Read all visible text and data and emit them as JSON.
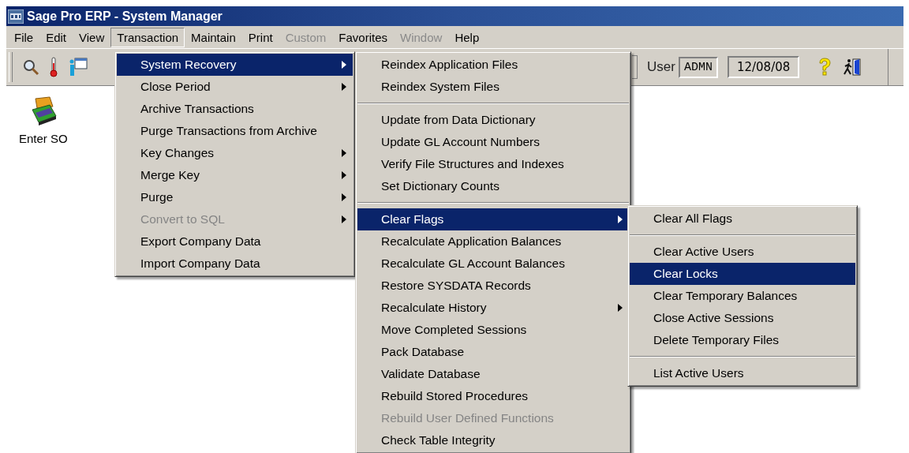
{
  "window": {
    "title": "Sage Pro ERP - System Manager"
  },
  "menu_bar": [
    {
      "label": "File",
      "selected": false,
      "disabled": false
    },
    {
      "label": "Edit",
      "selected": false,
      "disabled": false
    },
    {
      "label": "View",
      "selected": false,
      "disabled": false
    },
    {
      "label": "Transaction",
      "selected": true,
      "disabled": false
    },
    {
      "label": "Maintain",
      "selected": false,
      "disabled": false
    },
    {
      "label": "Print",
      "selected": false,
      "disabled": false
    },
    {
      "label": "Custom",
      "selected": false,
      "disabled": true
    },
    {
      "label": "Favorites",
      "selected": false,
      "disabled": false
    },
    {
      "label": "Window",
      "selected": false,
      "disabled": true
    },
    {
      "label": "Help",
      "selected": false,
      "disabled": false
    }
  ],
  "toolbar": {
    "user_label": "User",
    "user": "ADMN",
    "date": "12/08/08"
  },
  "desktop_icons": [
    {
      "label": "Enter SO"
    }
  ],
  "menus": [
    {
      "items": [
        {
          "kind": "item",
          "label": "System Recovery",
          "selected": true,
          "disabled": false,
          "submenu": true
        },
        {
          "kind": "item",
          "label": "Close Period",
          "selected": false,
          "disabled": false,
          "submenu": true
        },
        {
          "kind": "item",
          "label": "Archive Transactions",
          "selected": false,
          "disabled": false,
          "submenu": false
        },
        {
          "kind": "item",
          "label": "Purge Transactions from Archive",
          "selected": false,
          "disabled": false,
          "submenu": false
        },
        {
          "kind": "item",
          "label": "Key Changes",
          "selected": false,
          "disabled": false,
          "submenu": true
        },
        {
          "kind": "item",
          "label": "Merge Key",
          "selected": false,
          "disabled": false,
          "submenu": true
        },
        {
          "kind": "item",
          "label": "Purge",
          "selected": false,
          "disabled": false,
          "submenu": true
        },
        {
          "kind": "item",
          "label": "Convert to SQL",
          "selected": false,
          "disabled": true,
          "submenu": true
        },
        {
          "kind": "item",
          "label": "Export Company Data",
          "selected": false,
          "disabled": false,
          "submenu": false
        },
        {
          "kind": "item",
          "label": "Import Company Data",
          "selected": false,
          "disabled": false,
          "submenu": false
        }
      ]
    },
    {
      "items": [
        {
          "kind": "item",
          "label": "Reindex Application Files",
          "selected": false,
          "disabled": false,
          "submenu": false
        },
        {
          "kind": "item",
          "label": "Reindex System Files",
          "selected": false,
          "disabled": false,
          "submenu": false
        },
        {
          "kind": "separator"
        },
        {
          "kind": "item",
          "label": "Update from Data Dictionary",
          "selected": false,
          "disabled": false,
          "submenu": false
        },
        {
          "kind": "item",
          "label": "Update GL Account Numbers",
          "selected": false,
          "disabled": false,
          "submenu": false
        },
        {
          "kind": "item",
          "label": "Verify File Structures and Indexes",
          "selected": false,
          "disabled": false,
          "submenu": false
        },
        {
          "kind": "item",
          "label": "Set Dictionary Counts",
          "selected": false,
          "disabled": false,
          "submenu": false
        },
        {
          "kind": "separator"
        },
        {
          "kind": "item",
          "label": "Clear Flags",
          "selected": true,
          "disabled": false,
          "submenu": true
        },
        {
          "kind": "item",
          "label": "Recalculate Application Balances",
          "selected": false,
          "disabled": false,
          "submenu": false
        },
        {
          "kind": "item",
          "label": "Recalculate GL Account Balances",
          "selected": false,
          "disabled": false,
          "submenu": false
        },
        {
          "kind": "item",
          "label": "Restore SYSDATA Records",
          "selected": false,
          "disabled": false,
          "submenu": false
        },
        {
          "kind": "item",
          "label": "Recalculate History",
          "selected": false,
          "disabled": false,
          "submenu": true
        },
        {
          "kind": "item",
          "label": "Move Completed Sessions",
          "selected": false,
          "disabled": false,
          "submenu": false
        },
        {
          "kind": "item",
          "label": "Pack Database",
          "selected": false,
          "disabled": false,
          "submenu": false
        },
        {
          "kind": "item",
          "label": "Validate Database",
          "selected": false,
          "disabled": false,
          "submenu": false
        },
        {
          "kind": "item",
          "label": "Rebuild Stored Procedures",
          "selected": false,
          "disabled": false,
          "submenu": false
        },
        {
          "kind": "item",
          "label": "Rebuild User Defined Functions",
          "selected": false,
          "disabled": true,
          "submenu": false
        },
        {
          "kind": "item",
          "label": "Check Table Integrity",
          "selected": false,
          "disabled": false,
          "submenu": false
        }
      ]
    },
    {
      "items": [
        {
          "kind": "item",
          "label": "Clear All Flags",
          "selected": false,
          "disabled": false,
          "submenu": false
        },
        {
          "kind": "separator"
        },
        {
          "kind": "item",
          "label": "Clear Active Users",
          "selected": false,
          "disabled": false,
          "submenu": false
        },
        {
          "kind": "item",
          "label": "Clear Locks",
          "selected": true,
          "disabled": false,
          "submenu": false
        },
        {
          "kind": "item",
          "label": "Clear Temporary Balances",
          "selected": false,
          "disabled": false,
          "submenu": false
        },
        {
          "kind": "item",
          "label": "Close Active Sessions",
          "selected": false,
          "disabled": false,
          "submenu": false
        },
        {
          "kind": "item",
          "label": "Delete Temporary Files",
          "selected": false,
          "disabled": false,
          "submenu": false
        },
        {
          "kind": "separator"
        },
        {
          "kind": "item",
          "label": "List Active Users",
          "selected": false,
          "disabled": false,
          "submenu": false
        }
      ]
    }
  ]
}
